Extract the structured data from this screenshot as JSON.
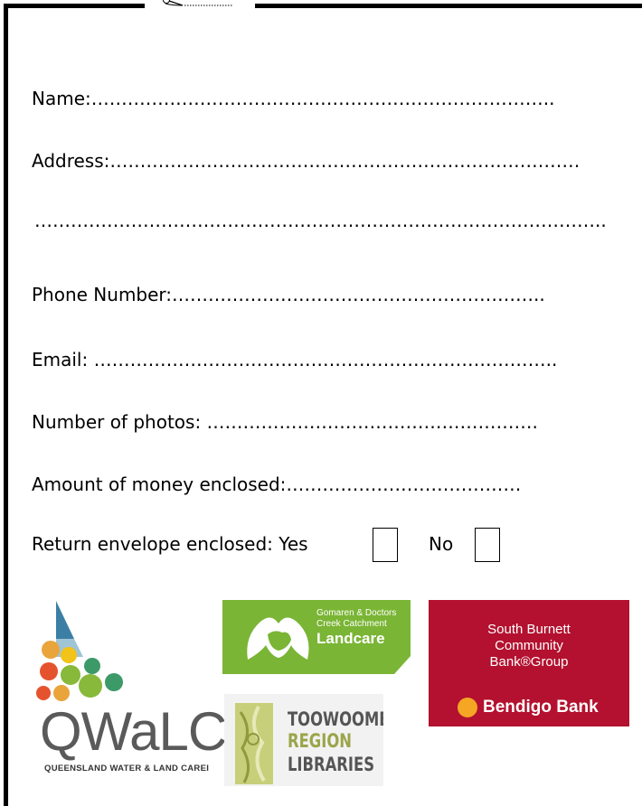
{
  "form": {
    "name": "Name:…………………………………………………………………..",
    "address": "Address:……………………………………………………………………",
    "address_line2": "…………………………………………………………………………………..",
    "phone": "Phone Number:……………………………………………………..",
    "email": "Email: …………………………………………………………………..",
    "photos": "Number of photos: ……………………………………………….",
    "amount": "Amount of money enclosed:…………………………………",
    "return_envelope": "Return envelope enclosed: Yes",
    "no_label": "No"
  },
  "logos": {
    "qwalc": {
      "wordmark": "QWaLC",
      "subtitle": "QUEENSLAND WATER & LAND CAREI",
      "colors": [
        "#3b7fa5",
        "#88b93a",
        "#e9a53b",
        "#e5532e",
        "#3c9a68",
        "#f2c318"
      ]
    },
    "landcare": {
      "line1": "Gomaren & Doctors",
      "line2": "Creek Catchment",
      "line3": "Landcare",
      "color": "#7ab535"
    },
    "toowoomba": {
      "line1": "TOOWOOMB",
      "line2": "REGION",
      "line3": "LIBRARIES"
    },
    "bendigo": {
      "line1": "South Burnett",
      "line2": "Community",
      "line3": "Bank®Group",
      "brand": "Bendigo Bank",
      "color": "#b3112f",
      "accent": "#f5a623"
    }
  },
  "icons": {
    "scissors": "scissors-icon"
  }
}
